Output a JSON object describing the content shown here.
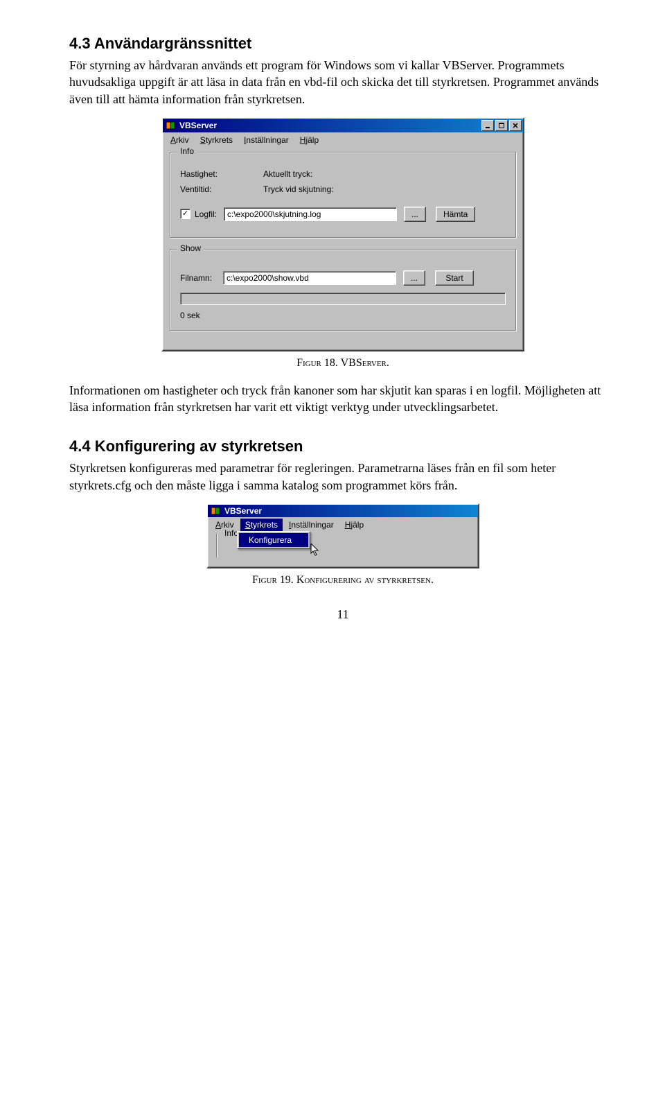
{
  "section43": {
    "heading": "4.3 Användargränssnittet",
    "para": "För styrning av hårdvaran används ett program för Windows som vi kallar VBServer. Programmets huvudsakliga uppgift är att läsa in data från en vbd-fil och skicka det till styrkretsen. Programmet används även till att hämta information från styrkretsen."
  },
  "figure18_caption_prefix": "Figur 18. ",
  "figure18_caption_rest": "VBServer.",
  "vbserver": {
    "title": "VBServer",
    "menu": {
      "arkiv": "Arkiv",
      "styrkrets": "Styrkrets",
      "installningar": "Inställningar",
      "hjalp": "Hjälp"
    },
    "info": {
      "legend": "Info",
      "hastighet_label": "Hastighet:",
      "ventiltid_label": "Ventiltid:",
      "aktuellt_tryck_label": "Aktuellt tryck:",
      "tryck_vid_skjutning_label": "Tryck vid skjutning:",
      "logfil_label": "Logfil:",
      "logfil_value": "c:\\expo2000\\skjutning.log",
      "browse_label": "...",
      "hamta_label": "Hämta"
    },
    "show": {
      "legend": "Show",
      "filnamn_label": "Filnamn:",
      "filnamn_value": "c:\\expo2000\\show.vbd",
      "browse_label": "...",
      "start_label": "Start",
      "progress_label": "0 sek"
    }
  },
  "after_fig18": "Informationen om hastigheter och tryck från kanoner som har skjutit kan sparas i en logfil. Möjligheten att läsa information från styrkretsen har varit ett viktigt verktyg under utvecklingsarbetet.",
  "section44": {
    "heading": "4.4 Konfigurering av styrkretsen",
    "para": "Styrkretsen konfigureras med parametrar för regleringen. Parametrarna läses från en fil som heter styrkrets.cfg och den måste ligga i samma katalog som programmet körs från."
  },
  "menu_open": {
    "info_legend": "Info",
    "konfigurera": "Konfigurera"
  },
  "figure19_caption_prefix": "Figur 19. ",
  "figure19_caption_rest": "Konfigurering av styrkretsen.",
  "page_number": "11"
}
